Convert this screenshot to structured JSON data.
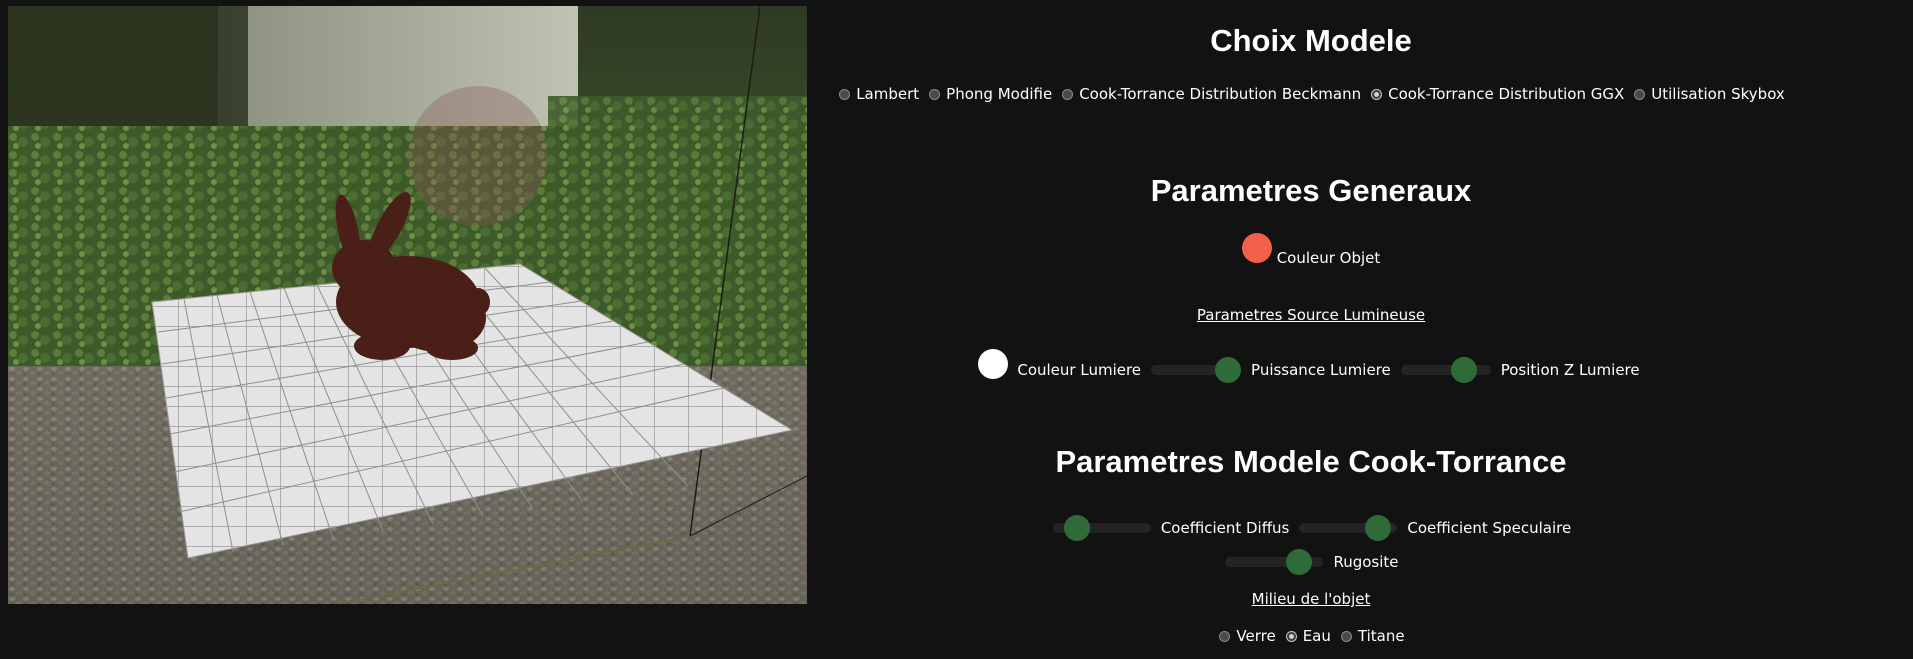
{
  "sections": {
    "model_choice": {
      "title": "Choix Modele",
      "options": [
        {
          "label": "Lambert",
          "checked": false
        },
        {
          "label": "Phong Modifie",
          "checked": false
        },
        {
          "label": "Cook-Torrance Distribution Beckmann",
          "checked": false
        },
        {
          "label": "Cook-Torrance Distribution GGX",
          "checked": true
        },
        {
          "label": "Utilisation Skybox",
          "checked": false
        }
      ]
    },
    "general": {
      "title": "Parametres Generaux",
      "object_color_label": "Couleur Objet",
      "object_color": "#f2604a",
      "light_section_link": "Parametres Source Lumineuse",
      "light_color_label": "Couleur Lumiere",
      "light_color": "#ffffff",
      "light_power_label": "Puissance Lumiere",
      "light_power_value": 0.85,
      "light_z_label": "Position Z Lumiere",
      "light_z_value": 0.7
    },
    "cook_torrance": {
      "title": "Parametres Modele Cook-Torrance",
      "diffuse_label": "Coefficient Diffus",
      "diffuse_value": 0.25,
      "specular_label": "Coefficient Speculaire",
      "specular_value": 0.8,
      "roughness_label": "Rugosite",
      "roughness_value": 0.75,
      "medium_link": "Milieu de l'objet",
      "media": [
        {
          "label": "Verre",
          "checked": false
        },
        {
          "label": "Eau",
          "checked": true
        },
        {
          "label": "Titane",
          "checked": false
        }
      ]
    }
  },
  "colors": {
    "background": "#121212",
    "slider_thumb": "#2f6b39",
    "slider_track": "#242424"
  }
}
